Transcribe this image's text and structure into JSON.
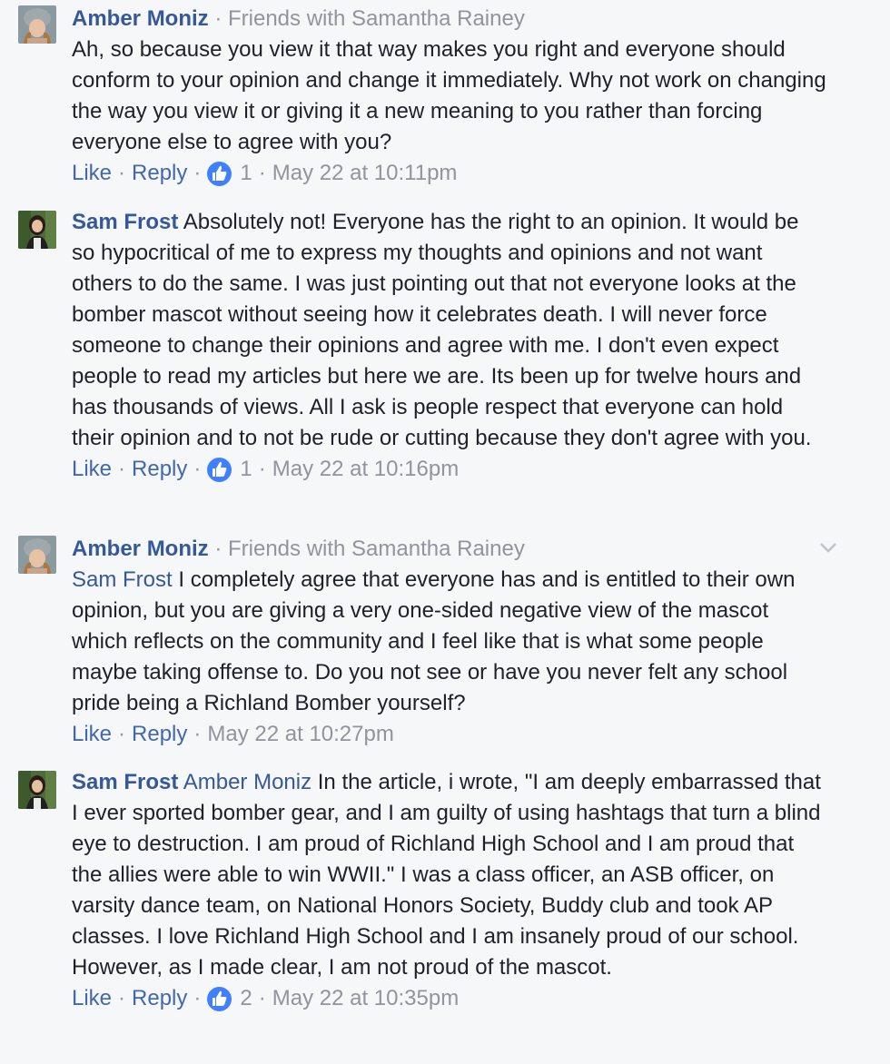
{
  "comments": [
    {
      "author": "Amber Moniz",
      "context": "· Friends with Samantha Rainey",
      "mention": "",
      "text": "Ah, so because you view it that way makes you right and everyone should conform to your opinion and change it immediately. Why not work on changing the way you view it or giving it a new meaning to you rather than forcing everyone else to agree with you?",
      "like_label": "Like",
      "reply_label": "Reply",
      "reaction_count": "1",
      "timestamp": "May 22 at 10:11pm"
    },
    {
      "author": "Sam Frost",
      "context": "",
      "mention": "",
      "text": "Absolutely not! Everyone has the right to an opinion. It would be so hypocritical of me to express my thoughts and opinions and not want others to do the same. I was just pointing out that not everyone looks at the bomber mascot without seeing how it celebrates death. I will never force someone to change their opinions and agree with me. I don't even expect people to read my articles but here we are. Its been up for twelve hours and has thousands of views. All I ask is people respect that everyone can hold their opinion and to not be rude or cutting because they don't agree with you.",
      "like_label": "Like",
      "reply_label": "Reply",
      "reaction_count": "1",
      "timestamp": "May 22 at 10:16pm"
    },
    {
      "author": "Amber Moniz",
      "context": "· Friends with Samantha Rainey",
      "mention": "Sam Frost",
      "text": "I completely agree that everyone has and is entitled to their own opinion, but you are giving a very one-sided negative view of the mascot which reflects on the community and I feel like that is what some people maybe taking offense to. Do you not see or have you never felt any school pride being a Richland Bomber yourself?",
      "like_label": "Like",
      "reply_label": "Reply",
      "reaction_count": "",
      "timestamp": "May 22 at 10:27pm"
    },
    {
      "author": "Sam Frost",
      "context": "",
      "mention": "Amber Moniz",
      "text": "In the article, i wrote, \"I am deeply embarrassed that I ever sported bomber gear, and I am guilty of using hashtags that turn a blind eye to destruction. I am proud of Richland High School and I am proud that the allies were able to win WWII.\" I was a class officer, an ASB officer, on varsity dance team, on National Honors Society, Buddy club and took AP classes. I love Richland High School and I am insanely proud of our school. However, as I made clear, I am not proud of the mascot.",
      "like_label": "Like",
      "reply_label": "Reply",
      "reaction_count": "2",
      "timestamp": "May 22 at 10:35pm"
    }
  ],
  "colors": {
    "link": "#365899",
    "action": "#4267b2",
    "meta": "#90949c",
    "like_badge": "#4080ff",
    "background": "#f6f7f9"
  }
}
